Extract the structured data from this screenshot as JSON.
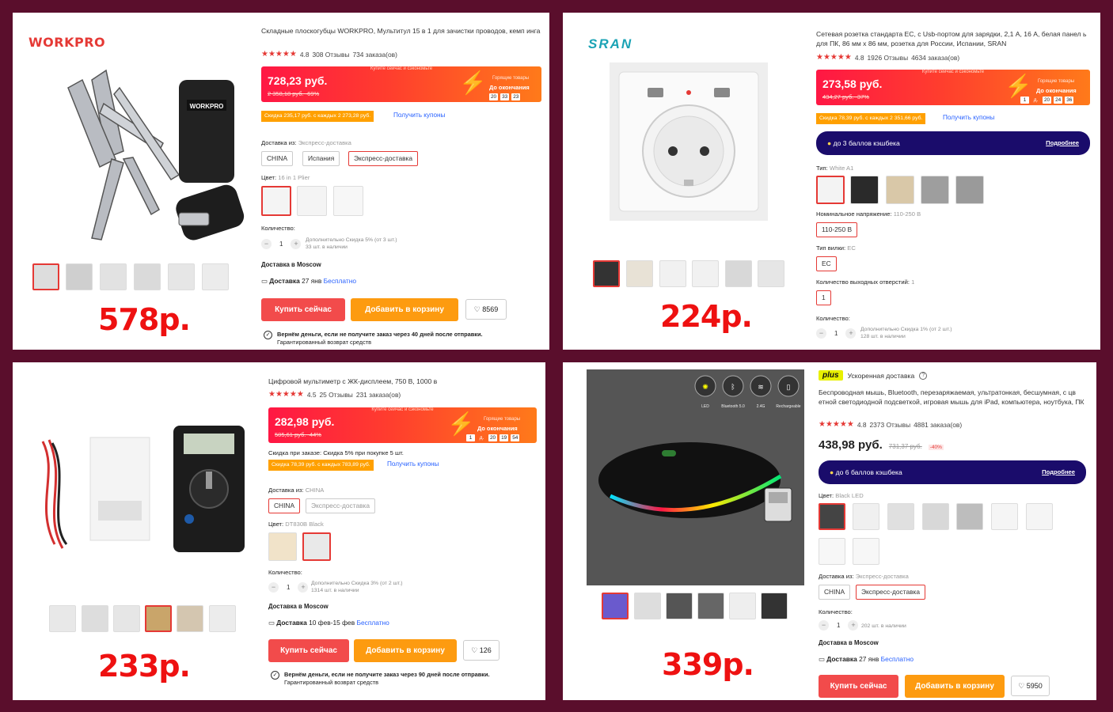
{
  "panels": [
    {
      "brand": "WORKPRO",
      "title": "Складные плоскогубцы WORKPRO, Мультитул 15 в 1 для зачистки проводов, кемп инга",
      "rating": "4.8",
      "reviews": "308 Отзывы",
      "orders": "734 заказа(ов)",
      "banner_top": "Купите сейчас и сэкономьте",
      "price": "728,23 руб.",
      "old_price": "2 358,18 руб.",
      "discount": "-69%",
      "ends_small": "Горящие товары",
      "ends_label": "До окончания",
      "countdown": [
        "20",
        "33",
        "23"
      ],
      "coupon": "Скидка 235,17 руб. с каждых 2 273,28 руб.",
      "coupon_link": "Получить купоны",
      "ship_from_label": "Доставка из:",
      "ship_from_value": "Экспресс-доставка",
      "ship_options": [
        "CHINA",
        "Испания",
        "Экспресс-доставка"
      ],
      "color_label": "Цвет:",
      "color_value": "16 in 1 Plier",
      "qty_label": "Количество:",
      "qty": "1",
      "qty_note1": "Дополнительно Скидка 5% (от 3 шт.)",
      "qty_note2": "33 шт. в наличии",
      "deliver_to": "Доставка в Moscow",
      "delivery_label": "Доставка",
      "delivery_date": "27 янв",
      "delivery_free": "Бесплатно",
      "buy": "Купить сейчас",
      "cart": "Добавить в корзину",
      "wishlist": "8569",
      "guarantee": "Вернём деньги, если не получите заказ через 40 дней после отправки.",
      "guarantee2": "Гарантированный возврат средств",
      "big_price": "578р."
    },
    {
      "brand": "SRAN",
      "title": "Сетевая розетка стандарта ЕС, с Usb-портом для зарядки, 2,1 А, 16 А, белая панел ь для ПК, 86 мм x 86 мм, розетка для России, Испании, SRAN",
      "rating": "4.8",
      "reviews": "1926 Отзывы",
      "orders": "4634 заказа(ов)",
      "banner_top": "Купите сейчас и сэкономьте",
      "price": "273,58 руб.",
      "old_price": "434,27 руб.",
      "discount": "-37%",
      "ends_small": "Горящие товары",
      "ends_label": "До окончания",
      "countdown": [
        "1",
        "д.",
        "20",
        "24",
        "36"
      ],
      "coupon": "Скидка 78,39 руб. с каждых 2 351,66 руб.",
      "coupon_link": "Получить купоны",
      "cashback": "до 3 баллов кэшбека",
      "cashback_more": "Подробнее",
      "type_label": "Тип:",
      "type_value": "White A1",
      "voltage_label": "Номинальное напряжение:",
      "voltage_value": "110-250 В",
      "voltage_opt": "110-250 В",
      "plug_label": "Тип вилки:",
      "plug_value": "EC",
      "plug_opt": "EC",
      "outlets_label": "Количество выходных отверстий:",
      "outlets_value": "1",
      "outlets_opt": "1",
      "qty_label": "Количество:",
      "qty": "1",
      "qty_note1": "Дополнительно Скидка 1% (от 2 шт.)",
      "qty_note2": "128 шт. в наличии",
      "big_price": "224р."
    },
    {
      "title": "Цифровой мультиметр с ЖК-дисплеем, 750 В, 1000 в",
      "rating": "4.5",
      "reviews": "25 Отзывы",
      "orders": "231 заказа(ов)",
      "banner_top": "Купите сейчас и сэкономьте",
      "price": "282,98 руб.",
      "old_price": "505,61 руб.",
      "discount": "-44%",
      "ends_small": "Горящие товары",
      "ends_label": "До окончания",
      "countdown": [
        "1",
        "д.",
        "20",
        "19",
        "54"
      ],
      "order_disc_label": "Скидка при заказе:",
      "order_disc_value": "Скидка 5% при покупке 5 шт.",
      "coupon": "Скидка 78,39 руб. с каждых 783,89 руб.",
      "coupon_link": "Получить купоны",
      "ship_from_label": "Доставка из:",
      "ship_from_value": "CHINA",
      "ship_options": [
        "CHINA",
        "Экспресс-доставка"
      ],
      "color_label": "Цвет:",
      "color_value": "DT830B Black",
      "qty_label": "Количество:",
      "qty": "1",
      "qty_note1": "Дополнительно Скидка 3% (от 2 шт.)",
      "qty_note2": "1314 шт. в наличии",
      "deliver_to": "Доставка в Moscow",
      "delivery_label": "Доставка",
      "delivery_date": "10 фев-15 фев",
      "delivery_free": "Бесплатно",
      "buy": "Купить сейчас",
      "cart": "Добавить в корзину",
      "wishlist": "126",
      "guarantee": "Вернём деньги, если не получите заказ через 90 дней после отправки.",
      "guarantee2": "Гарантированный возврат средств",
      "big_price": "233р."
    },
    {
      "plus": "plus",
      "fast": "Ускоренная доставка",
      "title": "Беспроводная мышь, Bluetooth, перезаряжаемая, ультратонкая, бесшумная, с цв етной светодиодной подсветкой, игровая мышь для iPad, компьютера, ноутбука, ПК",
      "rating": "4.8",
      "reviews": "2373 Отзывы",
      "orders": "4881 заказа(ов)",
      "price": "438,98 руб.",
      "old_price": "731,37 руб.",
      "discount": "-40%",
      "cashback": "до 6 баллов кэшбека",
      "cashback_more": "Подробнее",
      "color_label": "Цвет:",
      "color_value": "Black LED",
      "ship_from_label": "Доставка из:",
      "ship_from_value": "Экспресс-доставка",
      "ship_options": [
        "CHINA",
        "Экспресс-доставка"
      ],
      "qty_label": "Количество:",
      "qty": "1",
      "qty_note2": "202 шт. в наличии",
      "deliver_to": "Доставка в Moscow",
      "delivery_label": "Доставка",
      "delivery_date": "27 янв",
      "delivery_free": "Бесплатно",
      "buy": "Купить сейчас",
      "cart": "Добавить в корзину",
      "wishlist": "5950",
      "feature_labels": [
        "LED",
        "Bluetooth 5.0",
        "2.4G",
        "Rechargeable"
      ],
      "big_price": "339р."
    }
  ],
  "colors": {
    "accent_red": "#e53935",
    "price_red": "#ee1111",
    "cashback": "#1a0c6b",
    "cart_orange": "#fd9b10",
    "frame": "#5a0e2c"
  }
}
